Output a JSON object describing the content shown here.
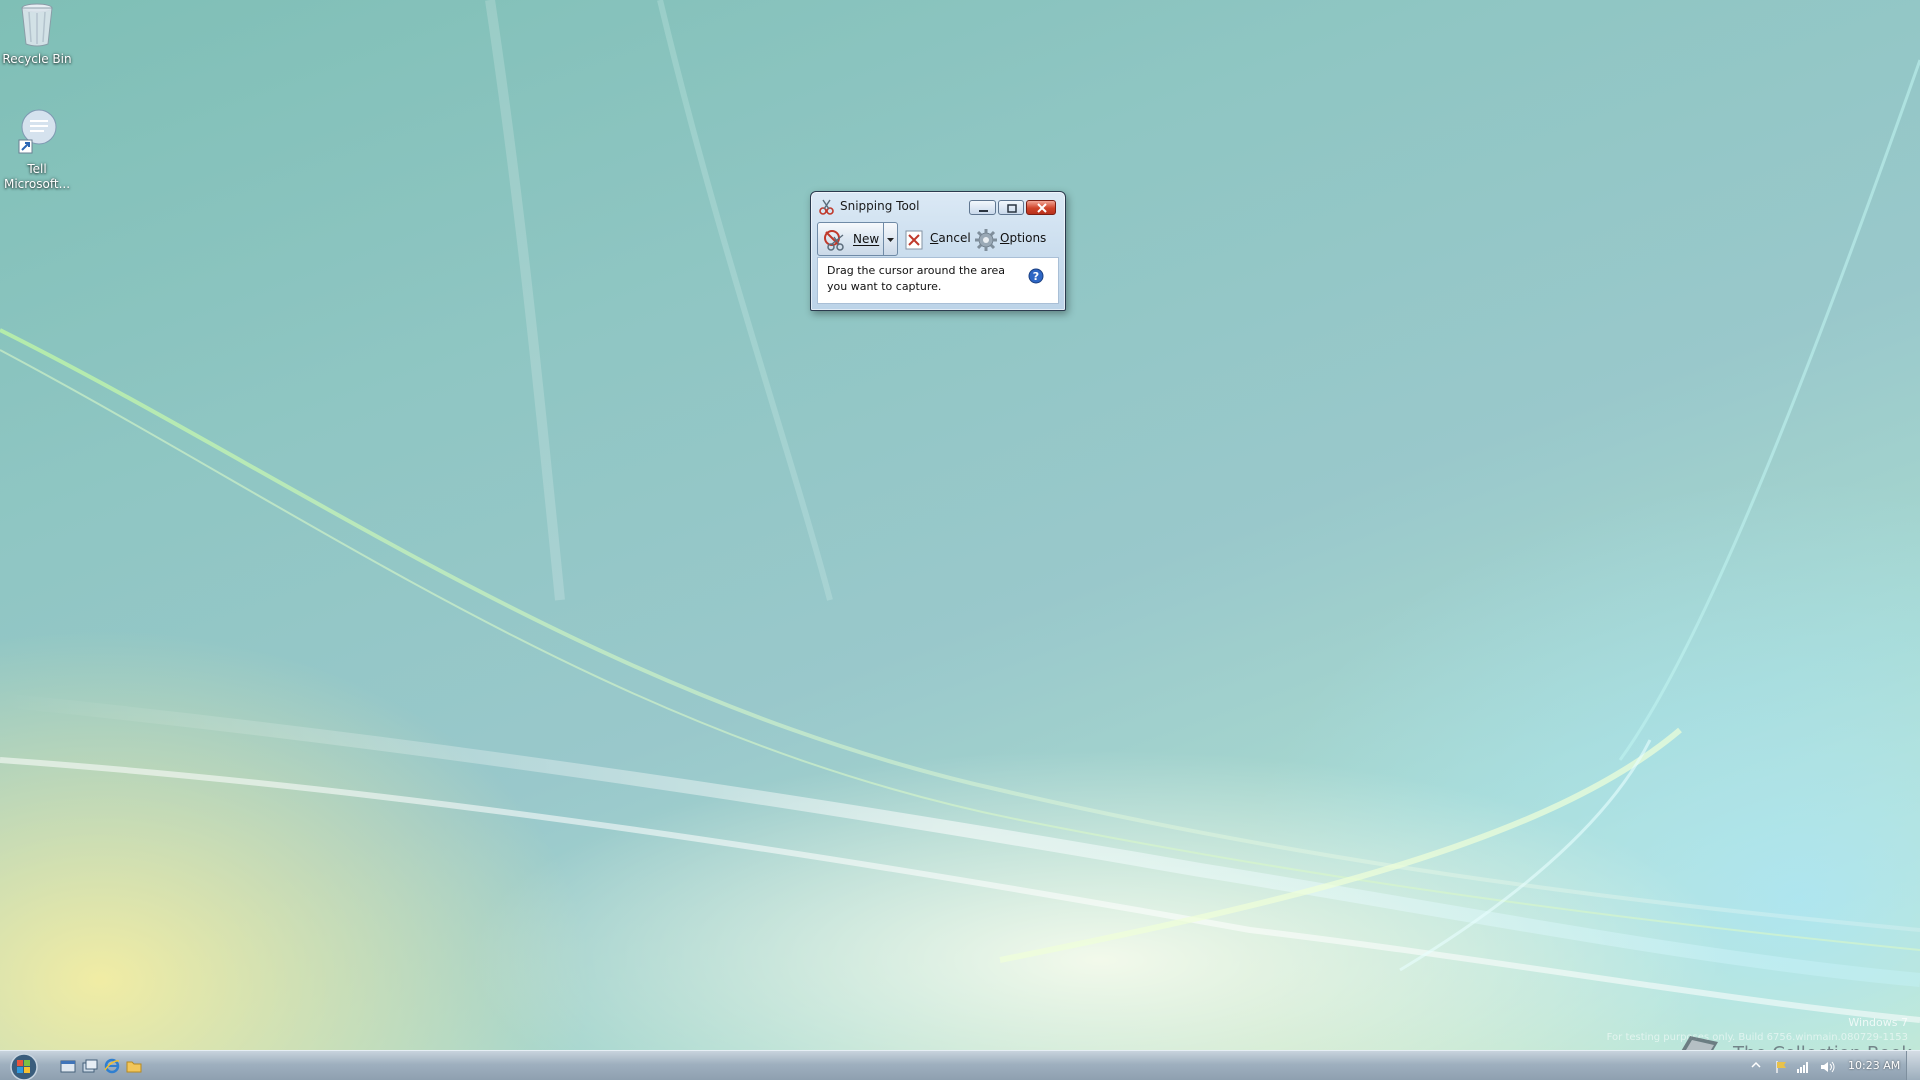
{
  "desktop": {
    "icons": [
      {
        "label": "Recycle Bin",
        "icon": "recycle-bin-icon"
      },
      {
        "label": "Tell Microsoft...",
        "icon": "feedback-icon"
      }
    ]
  },
  "window": {
    "title": "Snipping Tool",
    "icon": "scissors-icon",
    "toolbar": {
      "new_label": "New",
      "cancel_label": "Cancel",
      "options_label": "Options"
    },
    "instruction": "Drag the cursor around the area you want to capture."
  },
  "taskbar": {
    "clock": "10:23 AM",
    "watermark_os": "Windows 7",
    "watermark_build": "For testing purposes only. Build 6756.winmain.080729-1153",
    "collection_label": "The Collection Book"
  },
  "colors": {
    "close_button": "#d0442a",
    "help_icon": "#2e66c4",
    "taskbar": "#9fb0bf"
  }
}
